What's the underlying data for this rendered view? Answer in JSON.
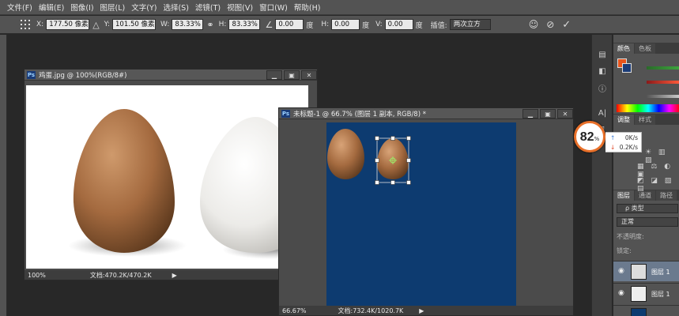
{
  "menu": [
    "文件(F)",
    "编辑(E)",
    "图像(I)",
    "图层(L)",
    "文字(Y)",
    "选择(S)",
    "滤镜(T)",
    "视图(V)",
    "窗口(W)",
    "帮助(H)"
  ],
  "options": {
    "x_label": "X:",
    "x_value": "177.50 像素",
    "y_label": "Y:",
    "y_value": "101.50 像素",
    "w_label": "W:",
    "w_value": "83.33%",
    "h_label": "H:",
    "h_value": "83.33%",
    "angle_value": "0.00",
    "angle_unit": "度",
    "hskew_label": "H:",
    "hskew_value": "0.00",
    "hskew_unit": "度",
    "vskew_label": "V:",
    "vskew_value": "0.00",
    "vskew_unit": "度",
    "interp_label": "插值:",
    "interp_value": "两次立方"
  },
  "doc1": {
    "title": "鸡蛋.jpg @ 100%(RGB/8#)",
    "zoom": "100%",
    "status": "文档:470.2K/470.2K"
  },
  "doc2": {
    "title": "未标题-1 @ 66.7% (图层 1 副本, RGB/8) *",
    "zoom": "66.67%",
    "status": "文档:732.4K/1020.7K"
  },
  "panels": {
    "color_tabs": [
      "颜色",
      "色板"
    ],
    "adjust_tabs": [
      "调整",
      "样式"
    ],
    "layer_tabs": [
      "图层",
      "通道",
      "路径"
    ],
    "kind_label": "ρ 类型",
    "blend_mode": "正常",
    "lock_label": "锁定:",
    "opacity_label": "不透明度:",
    "layers": [
      {
        "name": "图层 1"
      },
      {
        "name": "图层 1"
      }
    ],
    "foreground_color": "#e8541c",
    "background_color": "#1b3c78"
  },
  "overlay": {
    "percent": "82",
    "pct_sign": "%",
    "up_speed": "0K/s",
    "down_speed": "0.2K/s"
  }
}
